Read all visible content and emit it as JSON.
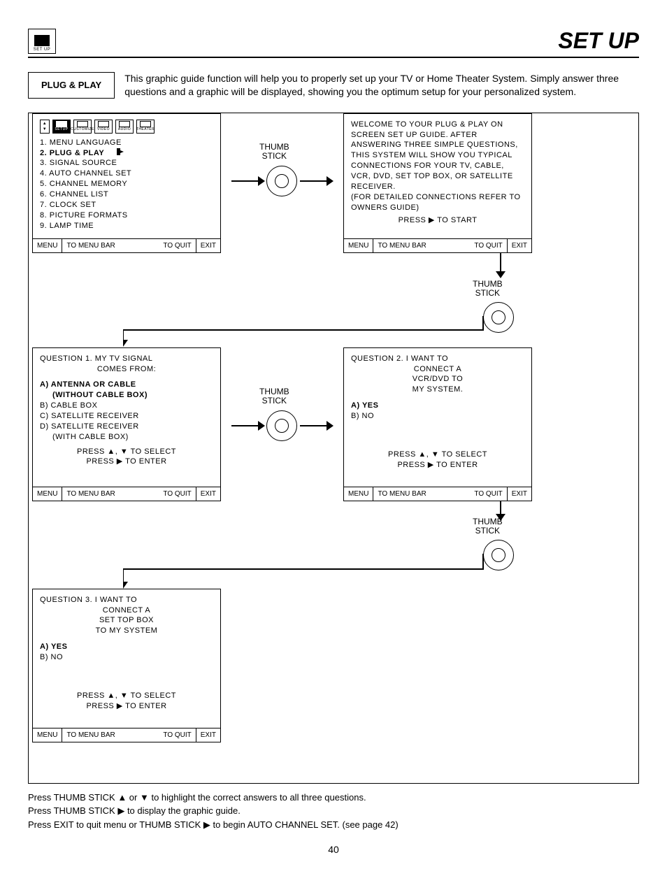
{
  "header": {
    "icon_label": "SET UP",
    "title": "SET UP"
  },
  "intro": {
    "section": "PLUG & PLAY",
    "text": "This graphic guide function will help you to properly set up your TV or Home Theater System.  Simply answer three questions and a graphic will be displayed, showing you the optimum setup for your personalized system."
  },
  "thumb_label": "THUMB\nSTICK",
  "panel_footer": {
    "menu": "MENU",
    "bar": "TO MENU BAR",
    "quit": "TO QUIT",
    "exit": "EXIT"
  },
  "menu_tabs": [
    "SETUP",
    "CUSTOMIZE",
    "VIDEO",
    "AUDIO",
    "THEATER"
  ],
  "panel1": {
    "items": [
      "1. MENU LANGUAGE",
      "2. PLUG & PLAY",
      "3. SIGNAL SOURCE",
      "4. AUTO CHANNEL SET",
      "5. CHANNEL MEMORY",
      "6. CHANNEL LIST",
      "7. CLOCK SET",
      "8. PICTURE FORMATS",
      "9. LAMP TIME"
    ],
    "selected_index": 1
  },
  "panel2": {
    "l1": "WELCOME TO YOUR PLUG & PLAY ON SCREEN SET UP GUIDE. AFTER ANSWERING THREE SIMPLE QUESTIONS, THIS SYSTEM WILL SHOW YOU TYPICAL CONNECTIONS FOR YOUR TV, CABLE, VCR, DVD, SET TOP BOX, OR SATELLITE RECEIVER.",
    "l2": "(FOR DETAILED CONNECTIONS REFER TO OWNERS GUIDE)",
    "start": "PRESS ▶ TO START"
  },
  "panel3": {
    "q": "QUESTION 1.  MY TV SIGNAL",
    "q2": "COMES FROM:",
    "a": "A) ANTENNA OR CABLE",
    "a2": "(WITHOUT CABLE BOX)",
    "b": "B) CABLE BOX",
    "c": "C) SATELLITE RECEIVER",
    "d": "D) SATELLITE RECEIVER",
    "d2": "(WITH CABLE BOX)",
    "sel": "PRESS ▲, ▼ TO SELECT",
    "ent": "PRESS ▶ TO ENTER"
  },
  "panel4": {
    "q": "QUESTION 2.  I WANT TO",
    "q2": "CONNECT A",
    "q3": "VCR/DVD TO",
    "q4": "MY SYSTEM.",
    "a": "A) YES",
    "b": "B) NO",
    "sel": "PRESS ▲, ▼ TO SELECT",
    "ent": "PRESS ▶ TO ENTER"
  },
  "panel5": {
    "q": "QUESTION 3.  I WANT TO",
    "q2": "CONNECT A",
    "q3": "SET TOP BOX",
    "q4": "TO MY SYSTEM",
    "a": "A) YES",
    "b": "B) NO",
    "sel": "PRESS ▲, ▼ TO SELECT",
    "ent": "PRESS ▶ TO ENTER"
  },
  "footnotes": {
    "l1": "Press  THUMB STICK ▲ or ▼ to highlight the correct answers to all three questions.",
    "l2": "Press THUMB STICK ▶ to display the graphic guide.",
    "l3": "Press EXIT to quit menu or THUMB STICK ▶ to begin AUTO CHANNEL SET. (see page 42)"
  },
  "page_number": "40"
}
